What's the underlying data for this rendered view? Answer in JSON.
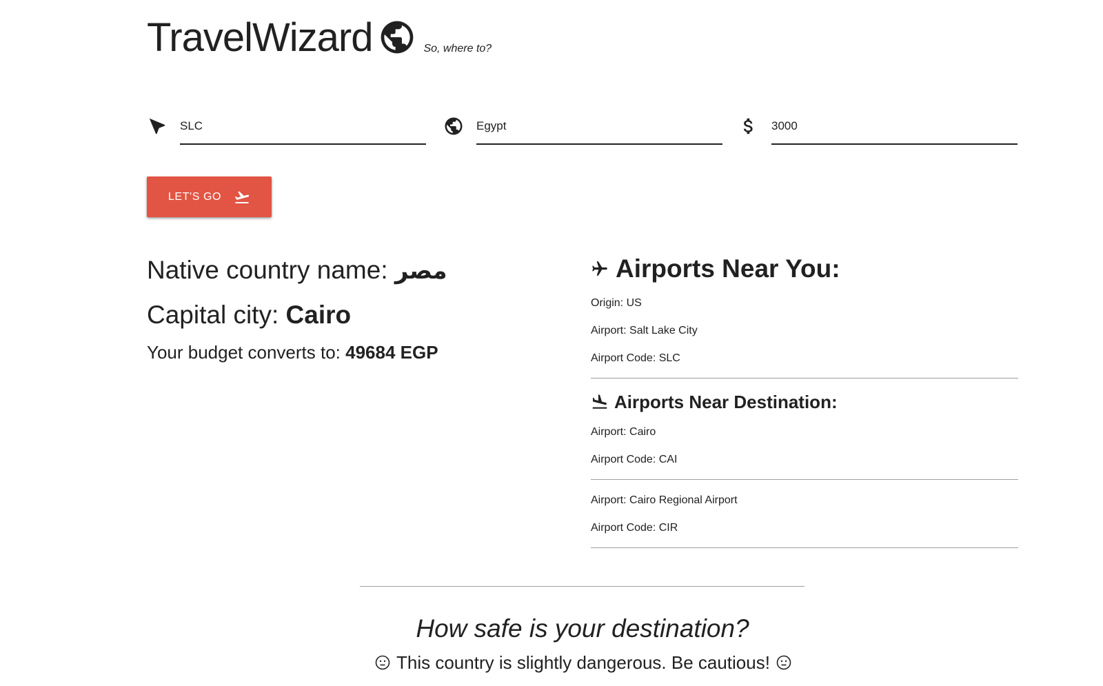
{
  "header": {
    "brand": "TravelWizard",
    "tagline": "So, where to?",
    "logo_icon": "globe-icon"
  },
  "form": {
    "origin": {
      "value": "SLC",
      "icon": "navigation-arrow-icon"
    },
    "destination": {
      "value": "Egypt",
      "icon": "globe-icon"
    },
    "budget": {
      "value": "3000",
      "icon": "dollar-icon"
    },
    "submit_label": "LET'S GO",
    "submit_icon": "flight-takeoff-icon"
  },
  "country": {
    "native_label": "Native country name:",
    "native_value": "مصر",
    "capital_label": "Capital city:",
    "capital_value": "Cairo",
    "budget_label": "Your budget converts to:",
    "budget_value": "49684 EGP"
  },
  "airports": {
    "near_you_title": "Airports Near You:",
    "near_you_icon": "airplane-icon",
    "origin_line": "Origin: US",
    "origin_airport_line": "Airport: Salt Lake City",
    "origin_code_line": "Airport Code: SLC",
    "near_dest_title": "Airports Near Destination:",
    "near_dest_icon": "flight-land-icon",
    "destinations": [
      {
        "airport": "Airport: Cairo",
        "code": "Airport Code: CAI"
      },
      {
        "airport": "Airport: Cairo Regional Airport",
        "code": "Airport Code: CIR"
      }
    ]
  },
  "safety": {
    "title": "How safe is your destination?",
    "message": "This country is slightly dangerous. Be cautious!",
    "icon": "neutral-face-icon"
  },
  "colors": {
    "accent": "#e25443",
    "text": "#212121",
    "rule": "#9e9e9e"
  }
}
